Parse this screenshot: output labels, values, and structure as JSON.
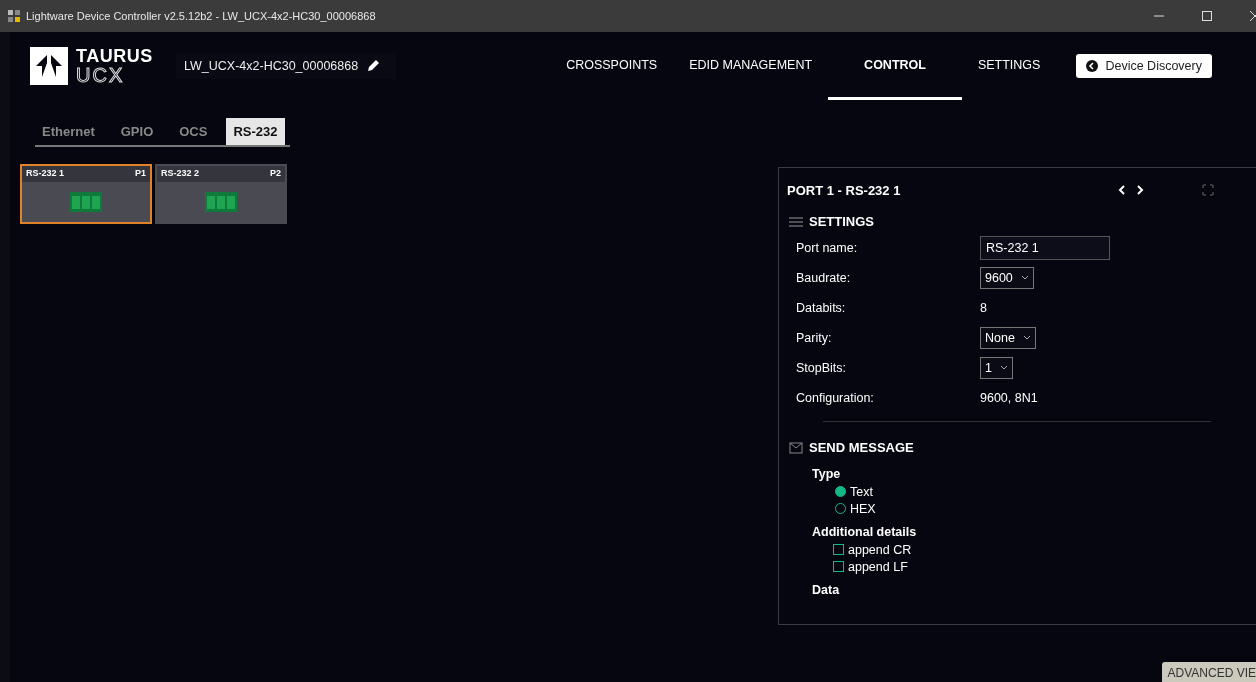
{
  "window": {
    "title": "Lightware Device Controller v2.5.12b2 - LW_UCX-4x2-HC30_00006868"
  },
  "logo": {
    "top": "TAURUS",
    "bottom": "UCX"
  },
  "device_name": "LW_UCX-4x2-HC30_00006868",
  "nav": [
    {
      "label": "CROSSPOINTS",
      "selected": false
    },
    {
      "label": "EDID MANAGEMENT",
      "selected": false
    },
    {
      "label": "CONTROL",
      "selected": true
    },
    {
      "label": "SETTINGS",
      "selected": false
    }
  ],
  "device_discovery": "Device Discovery",
  "subtabs": [
    {
      "label": "Ethernet",
      "selected": false
    },
    {
      "label": "GPIO",
      "selected": false
    },
    {
      "label": "OCS",
      "selected": false
    },
    {
      "label": "RS-232",
      "selected": true
    }
  ],
  "ports": [
    {
      "name": "RS-232 1",
      "port": "P1",
      "selected": true
    },
    {
      "name": "RS-232 2",
      "port": "P2",
      "selected": false
    }
  ],
  "panel": {
    "title": "PORT 1 - RS-232 1",
    "settings": {
      "heading": "SETTINGS",
      "rows": [
        {
          "kind": "input",
          "label": "Port name:",
          "value": "RS-232 1"
        },
        {
          "kind": "select",
          "label": "Baudrate:",
          "value": "9600"
        },
        {
          "kind": "text",
          "label": "Databits:",
          "value": "8"
        },
        {
          "kind": "select",
          "label": "Parity:",
          "value": "None"
        },
        {
          "kind": "select",
          "label": "StopBits:",
          "value": "1"
        },
        {
          "kind": "text",
          "label": "Configuration:",
          "value": "9600, 8N1"
        }
      ]
    },
    "send_message": {
      "heading": "SEND MESSAGE",
      "type_label": "Type",
      "types": [
        {
          "label": "Text",
          "selected": true
        },
        {
          "label": "HEX",
          "selected": false
        }
      ],
      "details_label": "Additional details",
      "details": [
        {
          "label": "append CR",
          "checked": false
        },
        {
          "label": "append LF",
          "checked": false
        }
      ],
      "data_label": "Data"
    }
  },
  "advanced_view": "ADVANCED VIE"
}
